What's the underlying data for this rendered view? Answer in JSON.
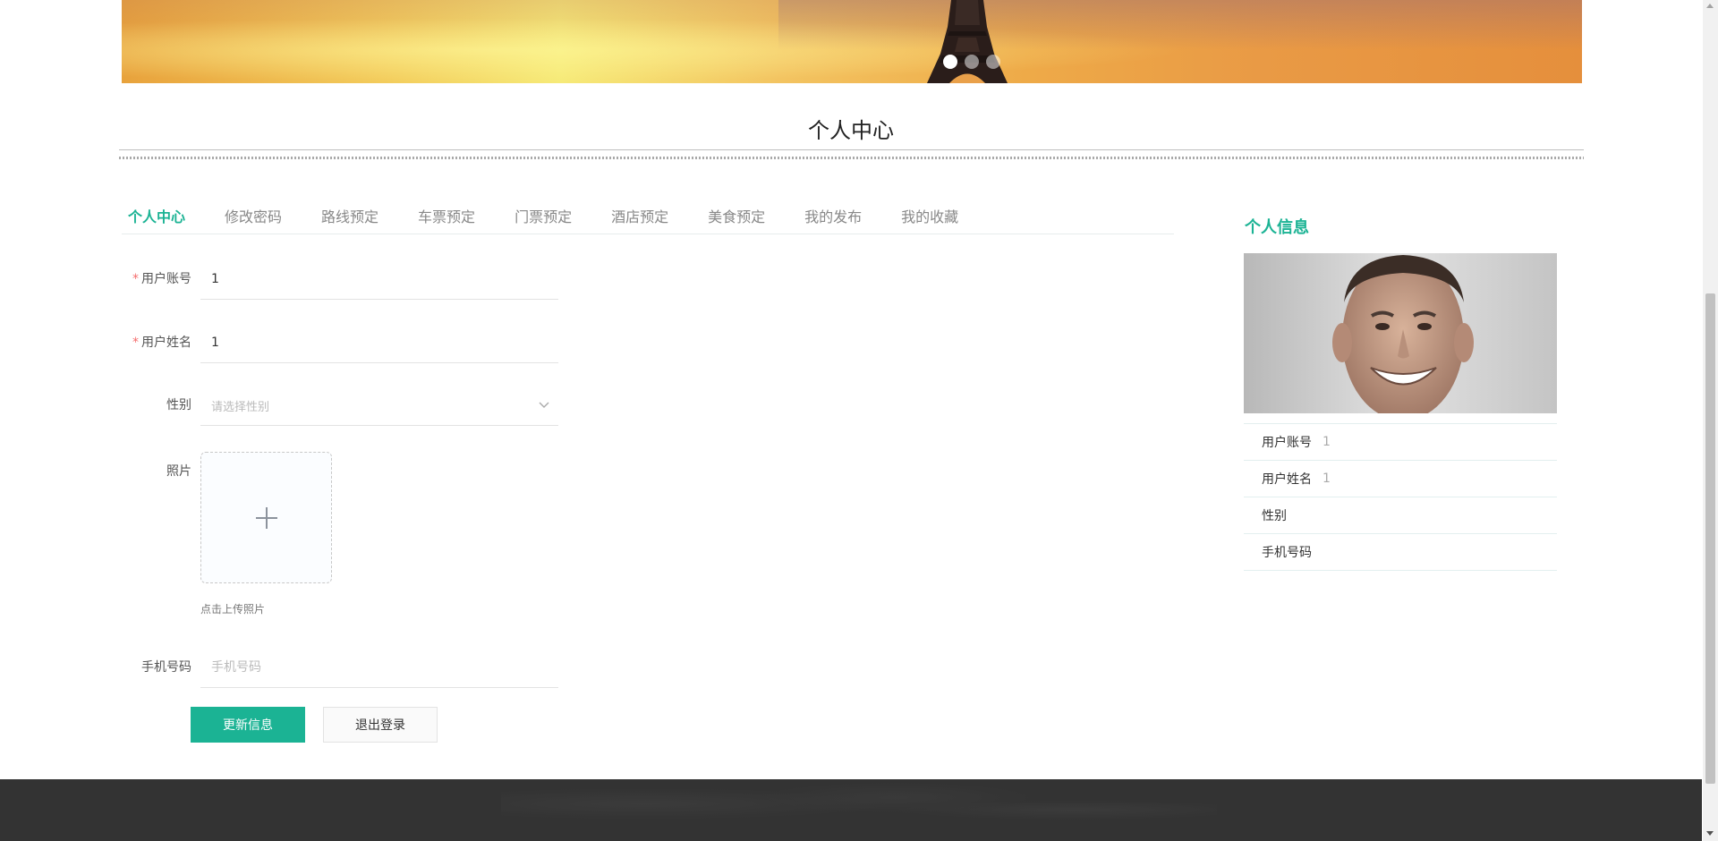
{
  "banner": {
    "slide_count": 3,
    "active_slide": 1
  },
  "page": {
    "title": "个人中心"
  },
  "tabs": [
    {
      "label": "个人中心",
      "active": true
    },
    {
      "label": "修改密码",
      "active": false
    },
    {
      "label": "路线预定",
      "active": false
    },
    {
      "label": "车票预定",
      "active": false
    },
    {
      "label": "门票预定",
      "active": false
    },
    {
      "label": "酒店预定",
      "active": false
    },
    {
      "label": "美食预定",
      "active": false
    },
    {
      "label": "我的发布",
      "active": false
    },
    {
      "label": "我的收藏",
      "active": false
    }
  ],
  "form": {
    "account": {
      "label": "用户账号",
      "required_mark": "*",
      "value": "1"
    },
    "name": {
      "label": "用户姓名",
      "required_mark": "*",
      "value": "1"
    },
    "gender": {
      "label": "性别",
      "placeholder": "请选择性别"
    },
    "photo": {
      "label": "照片",
      "tip": "点击上传照片"
    },
    "phone": {
      "label": "手机号码",
      "placeholder": "手机号码",
      "value": ""
    },
    "submit_label": "更新信息",
    "logout_label": "退出登录"
  },
  "sidebar": {
    "title": "个人信息",
    "items": [
      {
        "key": "用户账号",
        "value": "1"
      },
      {
        "key": "用户姓名",
        "value": "1"
      },
      {
        "key": "性别",
        "value": ""
      },
      {
        "key": "手机号码",
        "value": ""
      }
    ]
  },
  "colors": {
    "accent": "#1bb394",
    "required": "#f56c6c",
    "footer": "#333333"
  }
}
